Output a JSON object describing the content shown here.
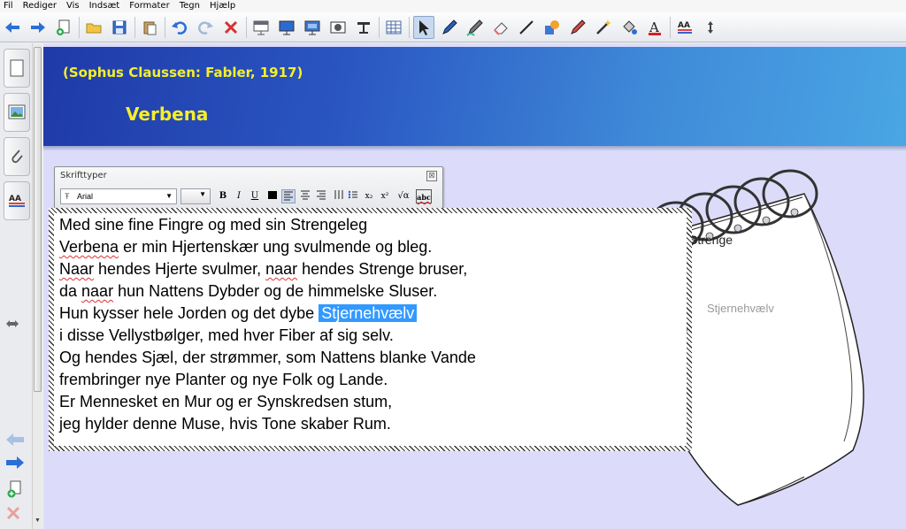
{
  "menu": [
    "Fil",
    "Rediger",
    "Vis",
    "Indsæt",
    "Formater",
    "Tegn",
    "Hjælp"
  ],
  "toolbar": {
    "buttons": [
      "back-arrow-icon",
      "forward-arrow-icon",
      "new-page-icon",
      "open-folder-icon",
      "save-disk-icon",
      "paste-icon",
      "undo-icon",
      "redo-icon",
      "delete-icon",
      "screen-shade-icon",
      "display-icon",
      "monitor-icon",
      "capture-icon",
      "projector-icon",
      "table-icon",
      "select-arrow-icon",
      "pen-icon",
      "creative-pen-icon",
      "eraser-icon",
      "line-icon",
      "shape-icon",
      "magic-pen-icon",
      "magic-wand-icon",
      "fill-icon",
      "text-color-icon",
      "properties-icon",
      "move-toolbar-icon"
    ]
  },
  "page": {
    "subtitle": "(Sophus Claussen: Fabler, 1917)",
    "title": "Verbena"
  },
  "notepad": {
    "word1": "Strenge",
    "word2": "Stjernehvælv"
  },
  "font_toolbar": {
    "title": "Skrifttyper",
    "close": "☒",
    "font": "Arial",
    "size": "",
    "bold": "B",
    "italic": "I",
    "underline": "U",
    "subscript": "x₂",
    "superscript": "x²",
    "equation": "√α",
    "spellcheck": "abc"
  },
  "poem": {
    "lines": [
      {
        "pre": "Med sine fine Fingre og med sin Strengeleg"
      },
      {
        "w1": "Verbena",
        "pre": " er min Hjertenskær ung svulmende og bleg."
      },
      {
        "w1": "Naar",
        "pre": " hendes Hjerte svulmer, ",
        "w2": "naar",
        "post": " hendes Strenge bruser,"
      },
      {
        "pre": "da ",
        "w1": "naar",
        "post": " hun Nattens Dybder og de himmelske Sluser."
      },
      {
        "pre": "Hun kysser hele Jorden og det dybe ",
        "hl": "Stjernehvælv"
      },
      {
        "pre": "i disse Vellystbølger, med hver Fiber af sig selv."
      },
      {
        "pre": "Og hendes Sjæl, der strømmer, som Nattens blanke Vande"
      },
      {
        "pre": "frembringer nye Planter og nye Folk og Lande."
      },
      {
        "pre": "Er Mennesket en Mur og er Synskredsen stum,"
      },
      {
        "pre": "jeg hylder denne Muse, hvis Tone skaber Rum."
      }
    ]
  },
  "colors": {
    "banner_start": "#1f3aa8",
    "banner_end": "#4aa6e4",
    "title_yellow": "#f5ef2a",
    "canvas_bg": "#dcdcfa",
    "selection": "#3399ff"
  }
}
